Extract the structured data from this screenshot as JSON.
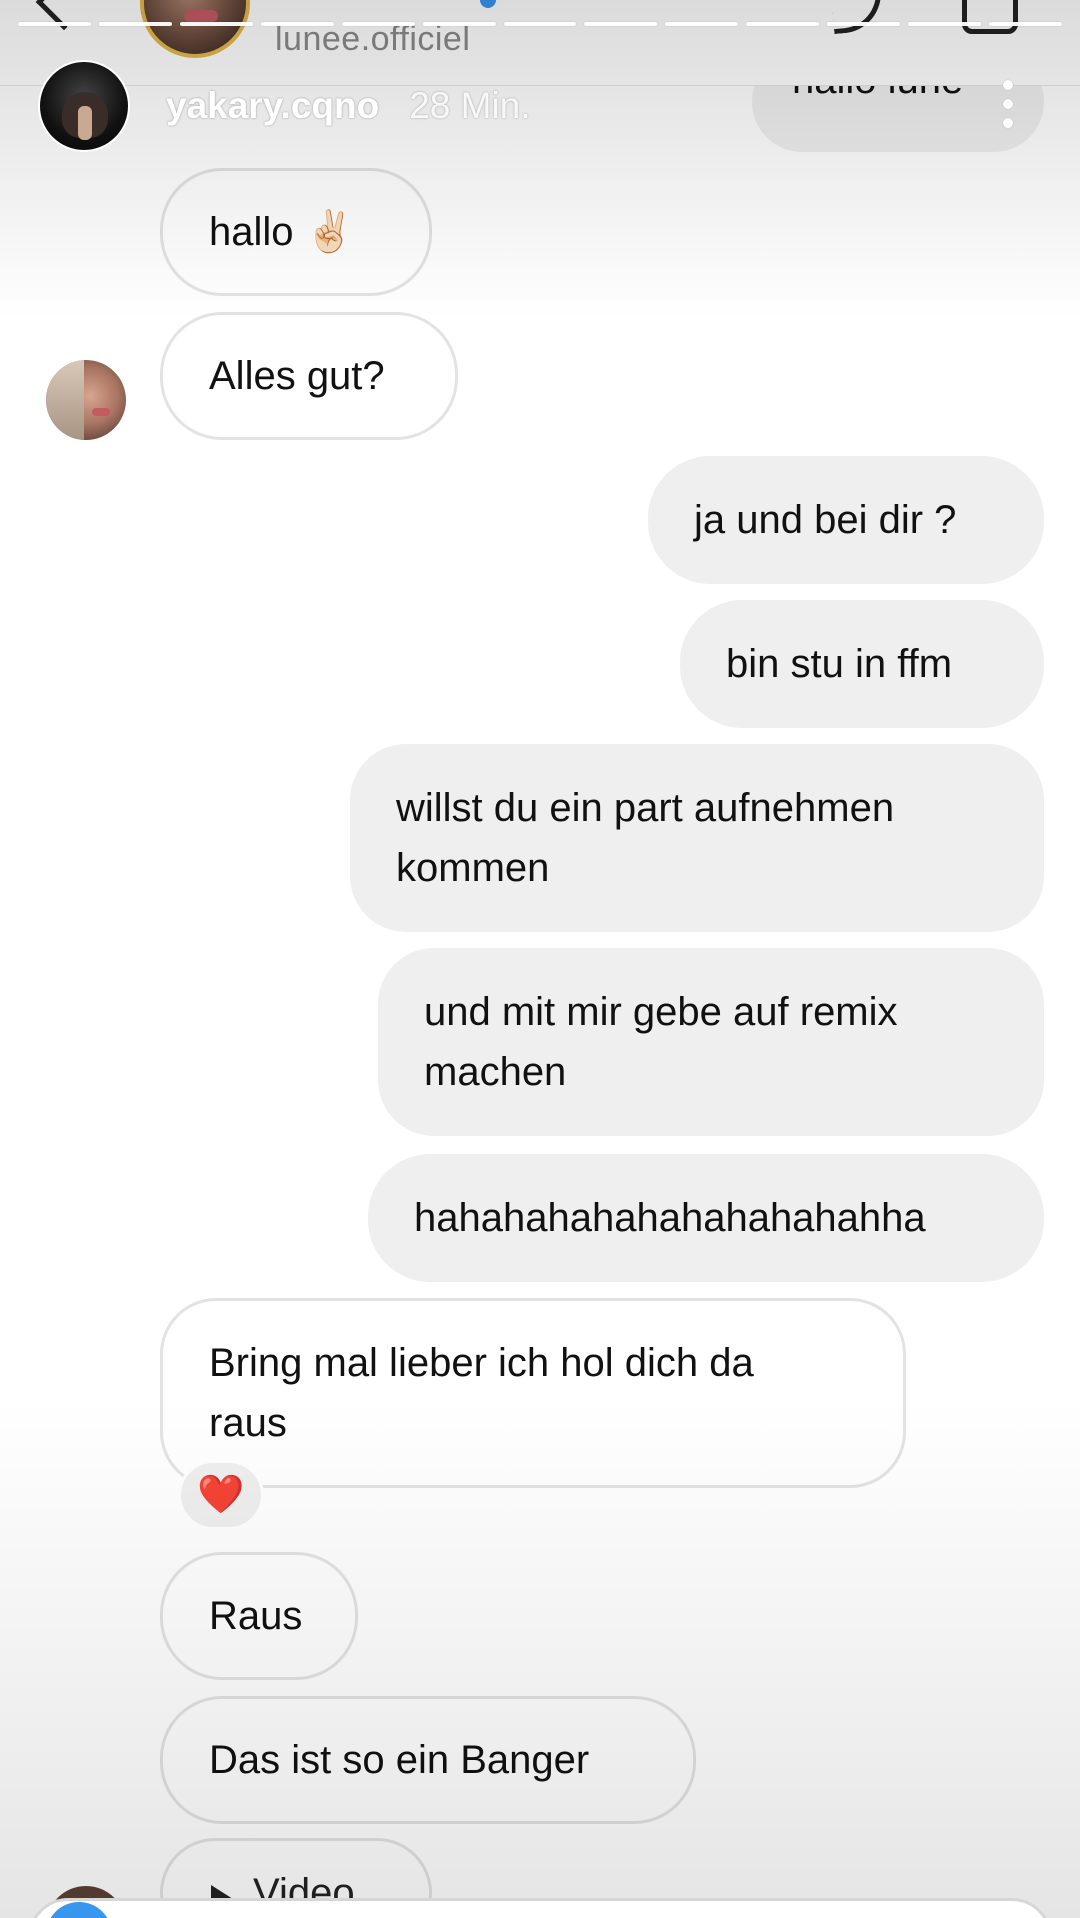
{
  "header": {
    "handle": "lunee.officiel"
  },
  "story_overlay": {
    "username": "yakary.cqno",
    "time": "28 Min.",
    "progress_segments": 13
  },
  "messages": [
    {
      "side": "out",
      "text": "hallo lune"
    },
    {
      "side": "in",
      "text": "hallo ✌🏻"
    },
    {
      "side": "in",
      "text": "Alles gut?"
    },
    {
      "side": "out",
      "text": "ja und bei dir ?"
    },
    {
      "side": "out",
      "text": "bin stu in ffm"
    },
    {
      "side": "out",
      "text": "willst du ein part aufnehmen\nkommen"
    },
    {
      "side": "out",
      "text": "und mit mir gebe auf remix\nmachen"
    },
    {
      "side": "out",
      "text": "hahahahahahahahahahahha"
    },
    {
      "side": "in",
      "text": "Bring mal lieber ich hol dich da\nraus",
      "reaction": "❤️"
    },
    {
      "side": "in",
      "text": "Raus"
    },
    {
      "side": "in",
      "text": "Das ist so ein Banger"
    },
    {
      "side": "in",
      "text": "Video"
    }
  ],
  "colors": {
    "incoming_bubble": "#ffffff",
    "incoming_border": "#e3e3e3",
    "outgoing_bubble": "#efefef",
    "verified": "#3897f0",
    "story_ring": "#e4b84a",
    "camera_button": "#3797ef"
  }
}
